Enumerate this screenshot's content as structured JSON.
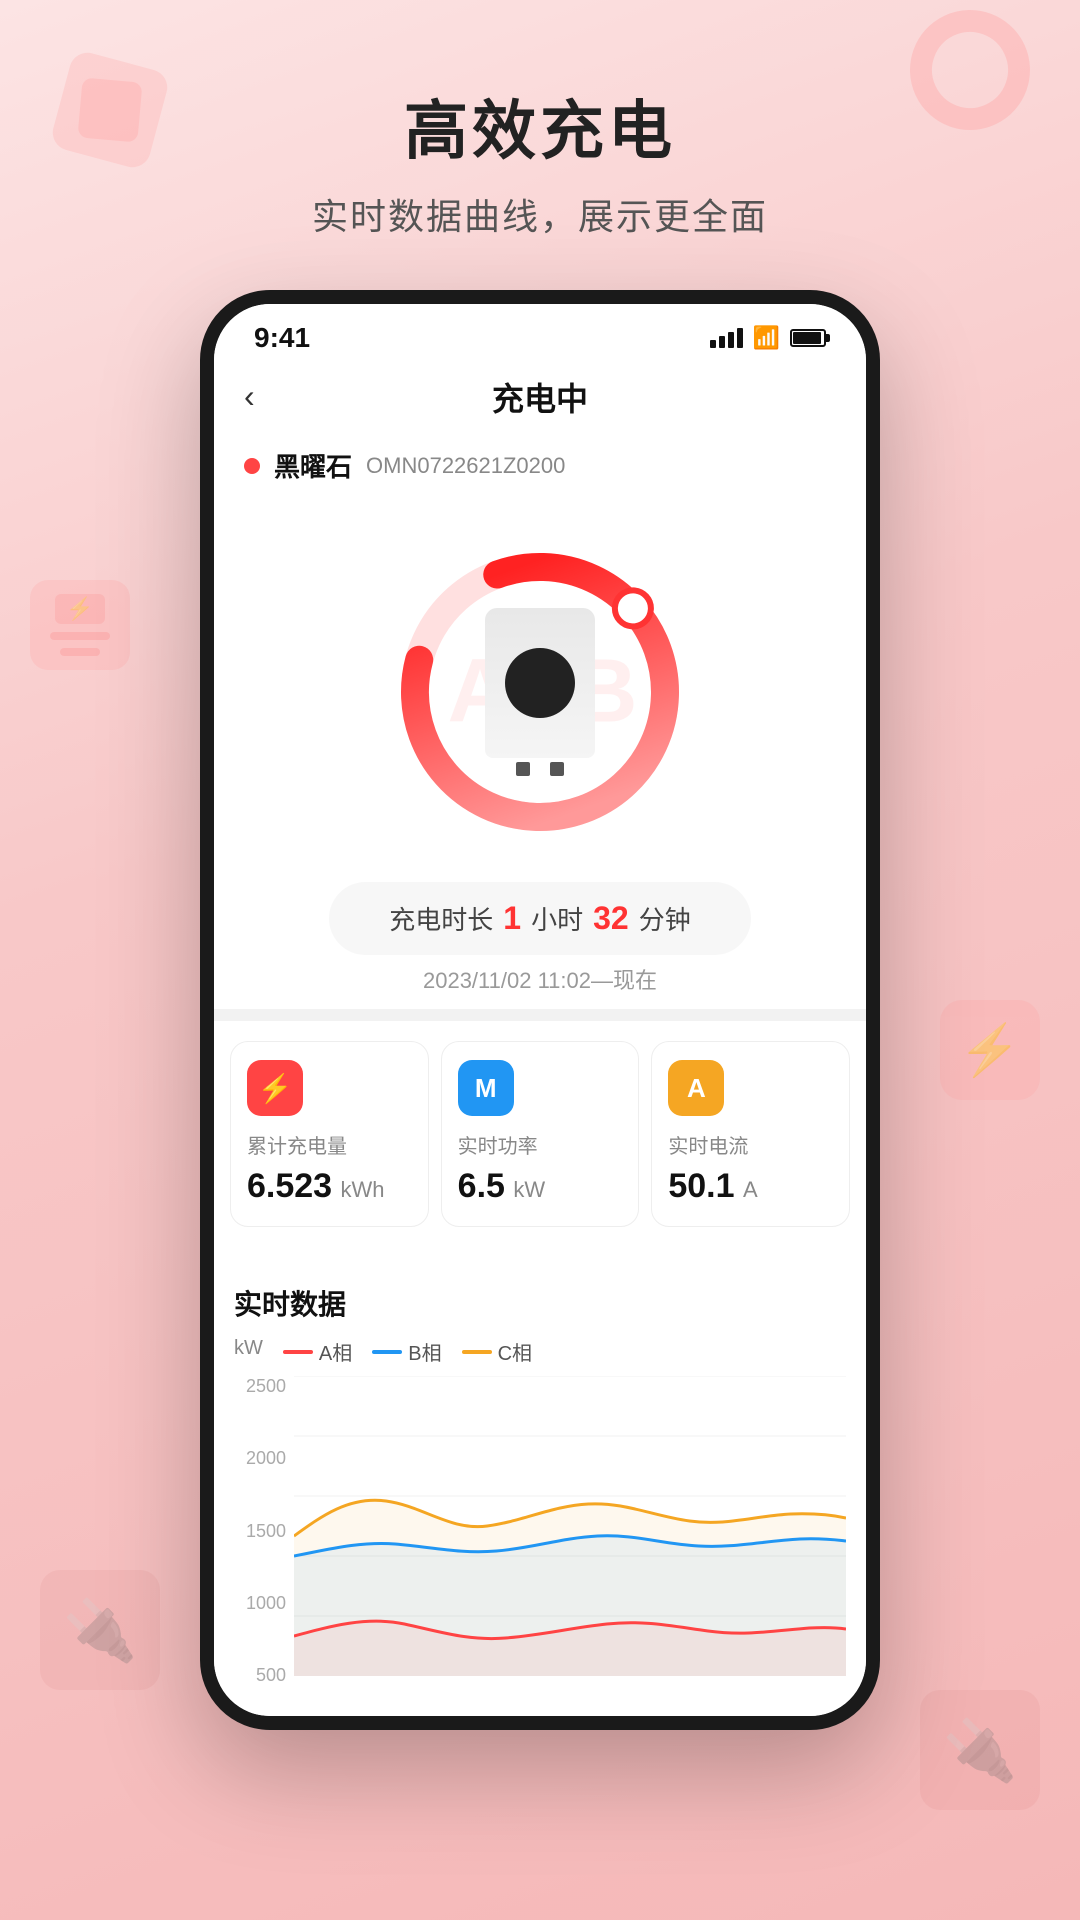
{
  "page": {
    "title": "高效充电",
    "subtitle": "实时数据曲线，展示更全面"
  },
  "status_bar": {
    "time": "9:41"
  },
  "nav": {
    "title": "充电中",
    "back_label": "‹"
  },
  "device": {
    "name": "黑曜石",
    "id": "OMN0722621Z0200",
    "status_color": "#ff4444"
  },
  "charging_time": {
    "label": "充电时长",
    "hours": "1",
    "hours_unit": "小时",
    "minutes": "32",
    "minutes_unit": "分钟",
    "date_range": "2023/11/02 11:02—现在"
  },
  "stats": [
    {
      "icon": "bolt",
      "icon_color": "red",
      "desc": "累计充电量",
      "value": "6.523",
      "unit": "kWh"
    },
    {
      "icon": "M",
      "icon_color": "blue",
      "desc": "实时功率",
      "value": "6.5",
      "unit": "kW"
    },
    {
      "icon": "A",
      "icon_color": "yellow",
      "desc": "实时电流",
      "value": "50.1",
      "unit": "A"
    }
  ],
  "chart": {
    "title": "实时数据",
    "y_label": "kW",
    "legend": [
      {
        "label": "A相",
        "color": "#ff4444"
      },
      {
        "label": "B相",
        "color": "#2196F3"
      },
      {
        "label": "C相",
        "color": "#F5A623"
      }
    ],
    "y_ticks": [
      "2500",
      "2000",
      "1500",
      "1000",
      "500"
    ],
    "watermark": "AOB"
  },
  "decorations": {
    "cube_tl": "decorative cube",
    "ring_tr": "decorative ring",
    "card_ml": "decorative card",
    "bolt_mr": "decorative bolt",
    "hand_bl": "decorative hand",
    "hand_br": "decorative hand"
  }
}
